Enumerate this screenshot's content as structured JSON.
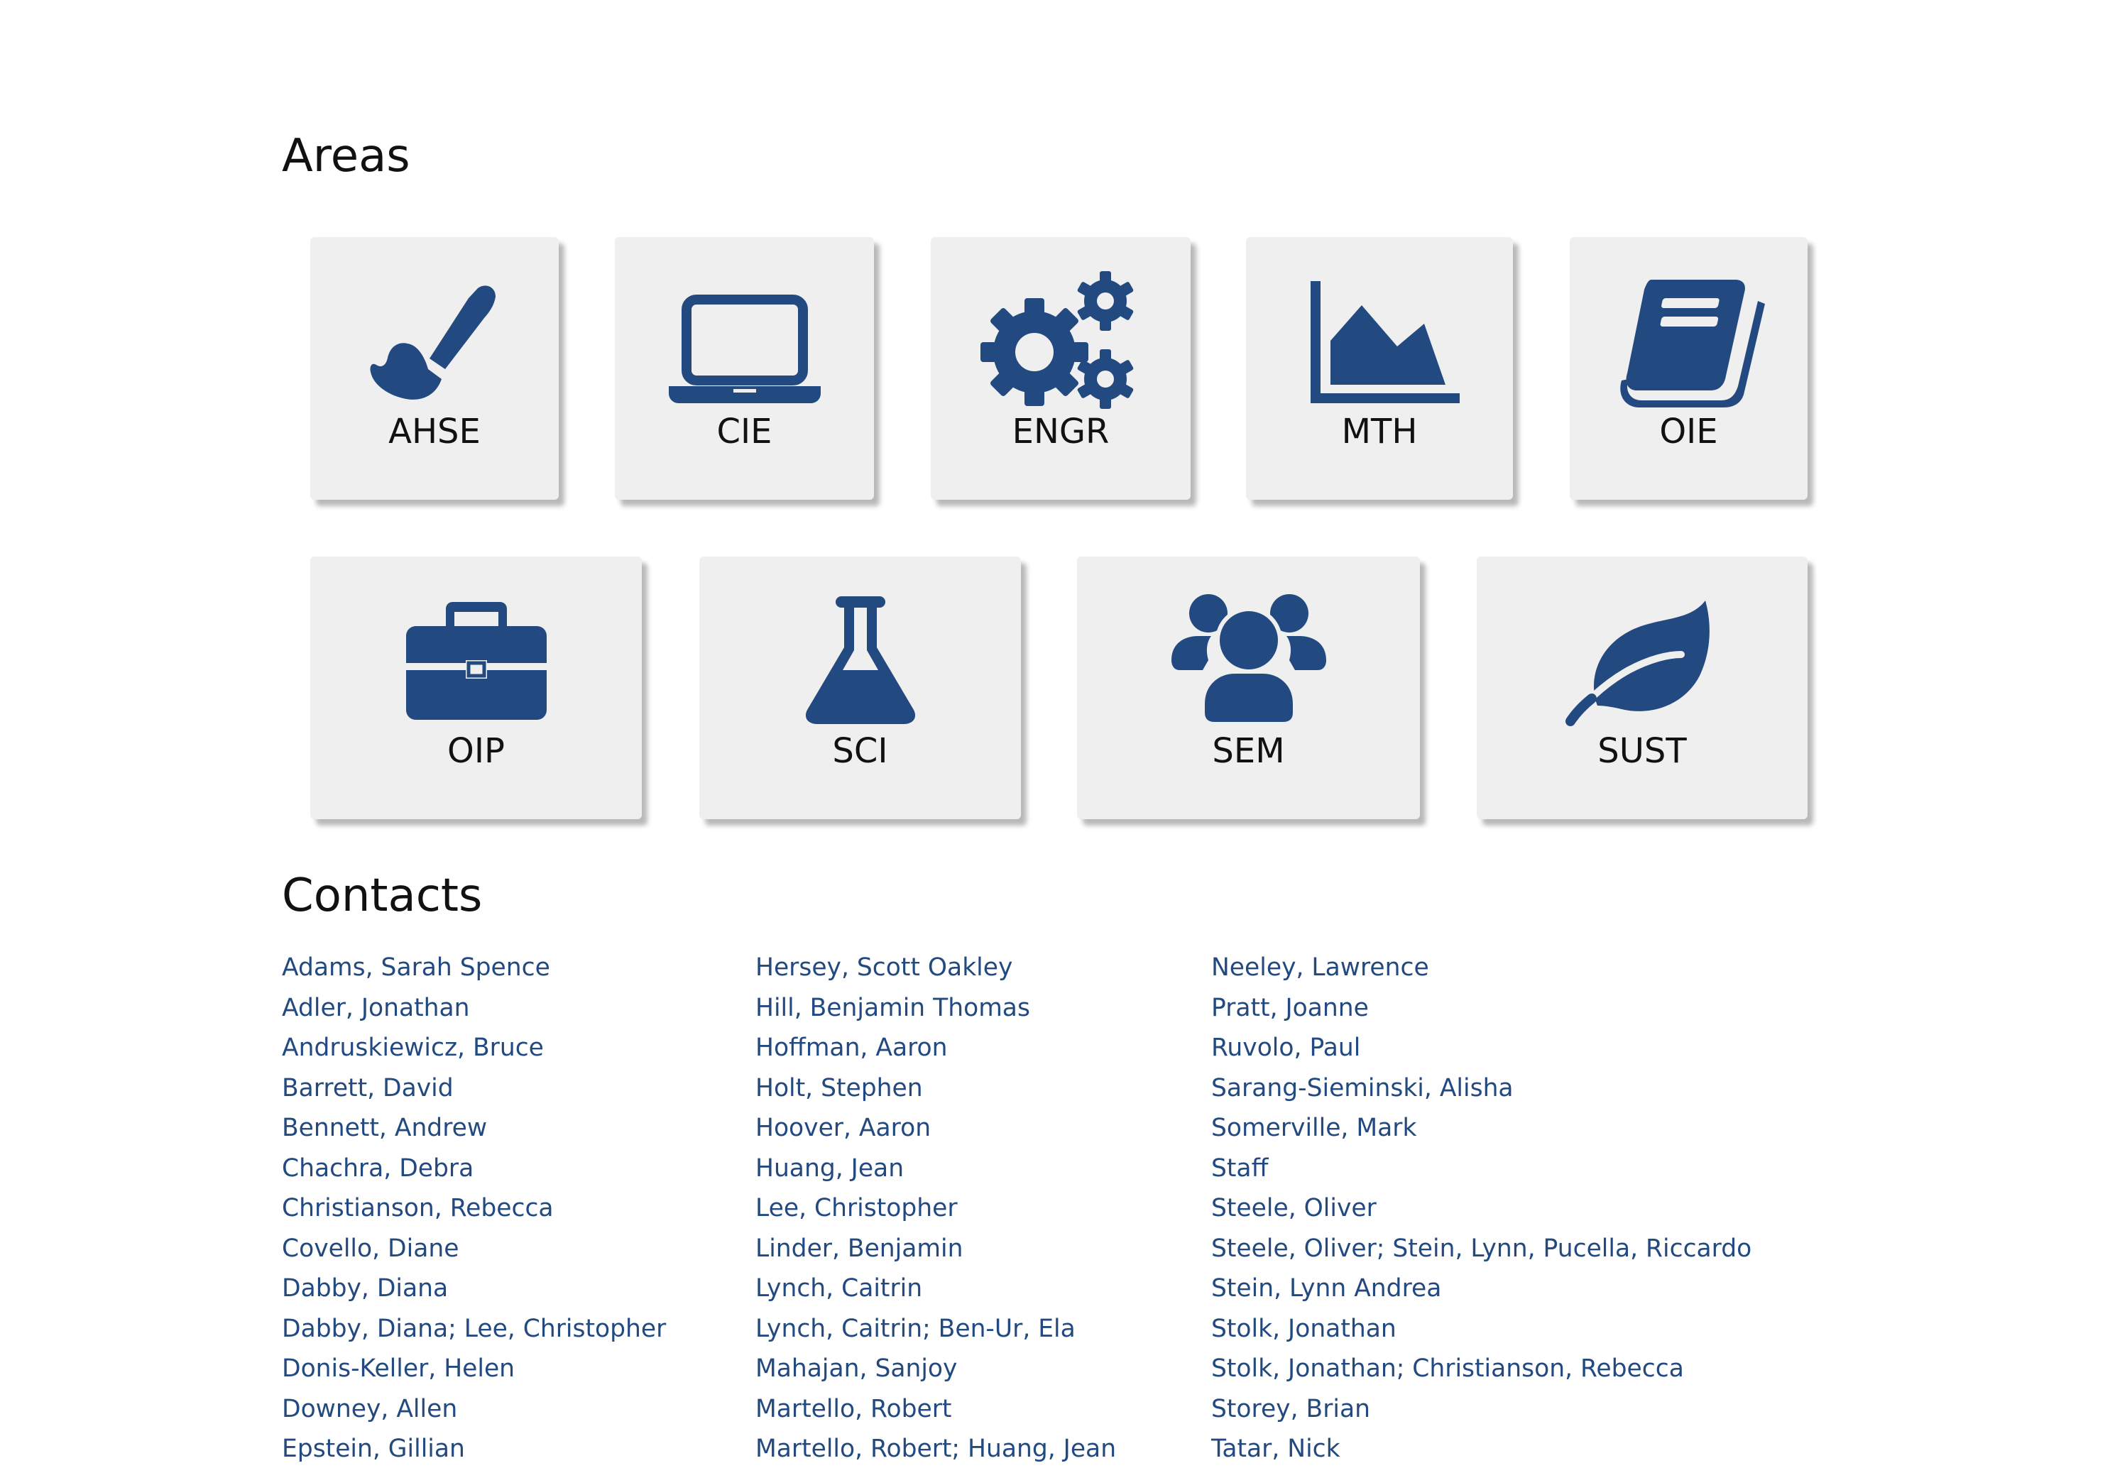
{
  "areas": {
    "title": "Areas",
    "icon_color": "#234a80",
    "tile_background": "#efefef",
    "tiles": [
      {
        "label": "AHSE",
        "icon": "paint-brush-icon"
      },
      {
        "label": "CIE",
        "icon": "laptop-icon"
      },
      {
        "label": "ENGR",
        "icon": "gears-icon"
      },
      {
        "label": "MTH",
        "icon": "area-chart-icon"
      },
      {
        "label": "OIE",
        "icon": "book-icon"
      },
      {
        "label": "OIP",
        "icon": "briefcase-icon"
      },
      {
        "label": "SCI",
        "icon": "flask-icon"
      },
      {
        "label": "SEM",
        "icon": "users-icon"
      },
      {
        "label": "SUST",
        "icon": "leaf-icon"
      }
    ]
  },
  "contacts": {
    "title": "Contacts",
    "link_color": "#234a80",
    "columns": [
      [
        "Adams, Sarah Spence",
        "Adler, Jonathan",
        "Andruskiewicz, Bruce",
        "Barrett, David",
        "Bennett, Andrew",
        "Chachra, Debra",
        "Christianson, Rebecca",
        "Covello, Diane",
        "Dabby, Diana",
        "Dabby, Diana; Lee, Christopher",
        "Donis-Keller, Helen",
        "Downey, Allen",
        "Epstein, Gillian"
      ],
      [
        "Hersey, Scott Oakley",
        "Hill, Benjamin Thomas",
        "Hoffman, Aaron",
        "Holt, Stephen",
        "Hoover, Aaron",
        "Huang, Jean",
        "Lee, Christopher",
        "Linder, Benjamin",
        "Lynch, Caitrin",
        "Lynch, Caitrin; Ben-Ur, Ela",
        "Mahajan, Sanjoy",
        "Martello, Robert",
        "Martello, Robert; Huang, Jean"
      ],
      [
        "Neeley, Lawrence",
        "Pratt, Joanne",
        "Ruvolo, Paul",
        "Sarang-Sieminski, Alisha",
        "Somerville, Mark",
        "Staff",
        "Steele, Oliver",
        "Steele, Oliver; Stein, Lynn, Pucella, Riccardo",
        "Stein, Lynn Andrea",
        "Stolk, Jonathan",
        "Stolk, Jonathan; Christianson, Rebecca",
        "Storey, Brian",
        "Tatar, Nick"
      ]
    ]
  }
}
